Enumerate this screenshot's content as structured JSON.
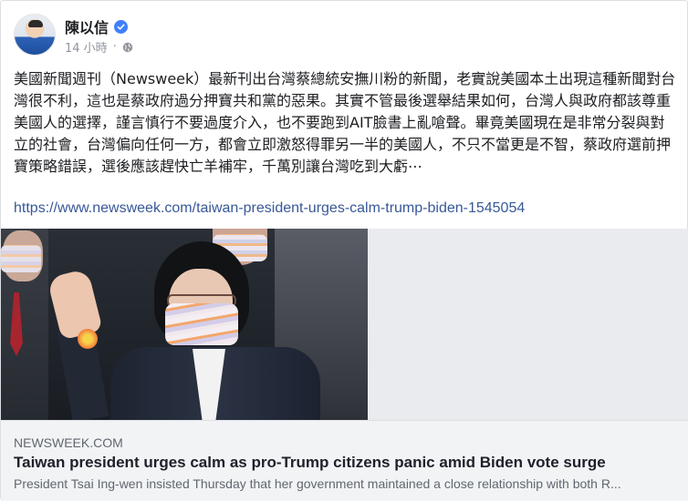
{
  "post": {
    "author": "陳以信",
    "timestamp": "14 小時",
    "separator": "·",
    "audience_icon": "globe-icon",
    "verified_icon": "verified-badge-icon",
    "body_text": "美國新聞週刊（Newsweek）最新刊出台灣蔡總統安撫川粉的新聞，老實說美國本土出現這種新聞對台灣很不利，這也是蔡政府過分押寶共和黨的惡果。其實不管最後選舉結果如何，台灣人與政府都該尊重美國人的選擇，謹言慎行不要過度介入，也不要跑到AIT臉書上亂嗆聲。畢竟美國現在是非常分裂與對立的社會，台灣偏向任何一方，都會立即激怒得罪另一半的美國人，不只不當更是不智，蔡政府選前押寶策略錯誤，選後應該趕快亡羊補牢，千萬別讓台灣吃到大虧⋯",
    "link_url": "https://www.newsweek.com/taiwan-president-urges-calm-trump-biden-1545054"
  },
  "preview": {
    "domain": "NEWSWEEK.COM",
    "headline": "Taiwan president urges calm as pro-Trump citizens panic amid Biden vote surge",
    "description": "President Tsai Ing-wen insisted Thursday that her government maintained a close relationship with both R..."
  },
  "colors": {
    "link": "#385898",
    "verified": "#4080ff",
    "caption_bg": "#f2f3f5"
  }
}
